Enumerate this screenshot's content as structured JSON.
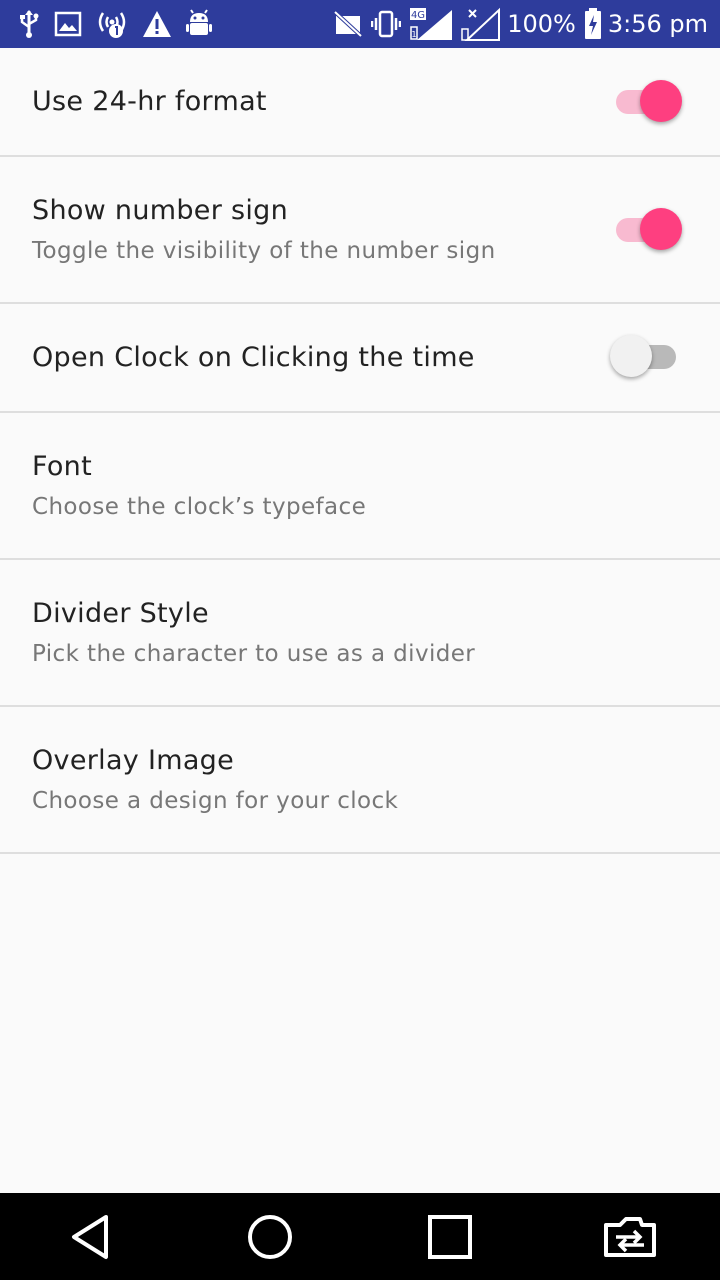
{
  "status_bar": {
    "left_icons": [
      "usb-icon",
      "image-icon",
      "hotspot-icon",
      "warning-icon",
      "android-icon"
    ],
    "right_icons": [
      "no-sim-icon",
      "vibrate-icon",
      "signal-4g-icon",
      "signal-no-service-icon",
      "battery-charging-icon"
    ],
    "network_label": "4G",
    "battery_percent": "100%",
    "time": "3:56 pm"
  },
  "settings": {
    "use_24hr": {
      "title": "Use 24-hr format",
      "enabled": true
    },
    "show_number_sign": {
      "title": "Show number sign",
      "subtitle": "Toggle the visibility of the number sign",
      "enabled": true
    },
    "open_clock": {
      "title": "Open Clock on Clicking the time",
      "enabled": false
    },
    "font": {
      "title": "Font",
      "subtitle": "Choose the clock’s typeface"
    },
    "divider_style": {
      "title": "Divider Style",
      "subtitle": "Pick the character to use as a divider"
    },
    "overlay_image": {
      "title": "Overlay Image",
      "subtitle": "Choose a design for your clock"
    }
  },
  "colors": {
    "status_bar": "#2e3c9c",
    "accent": "#fe3f80",
    "accent_track": "#f8bad0",
    "background": "#fafafa"
  },
  "nav_bar": {
    "icons": [
      "back-icon",
      "home-icon",
      "recents-icon",
      "switch-app-icon"
    ]
  }
}
